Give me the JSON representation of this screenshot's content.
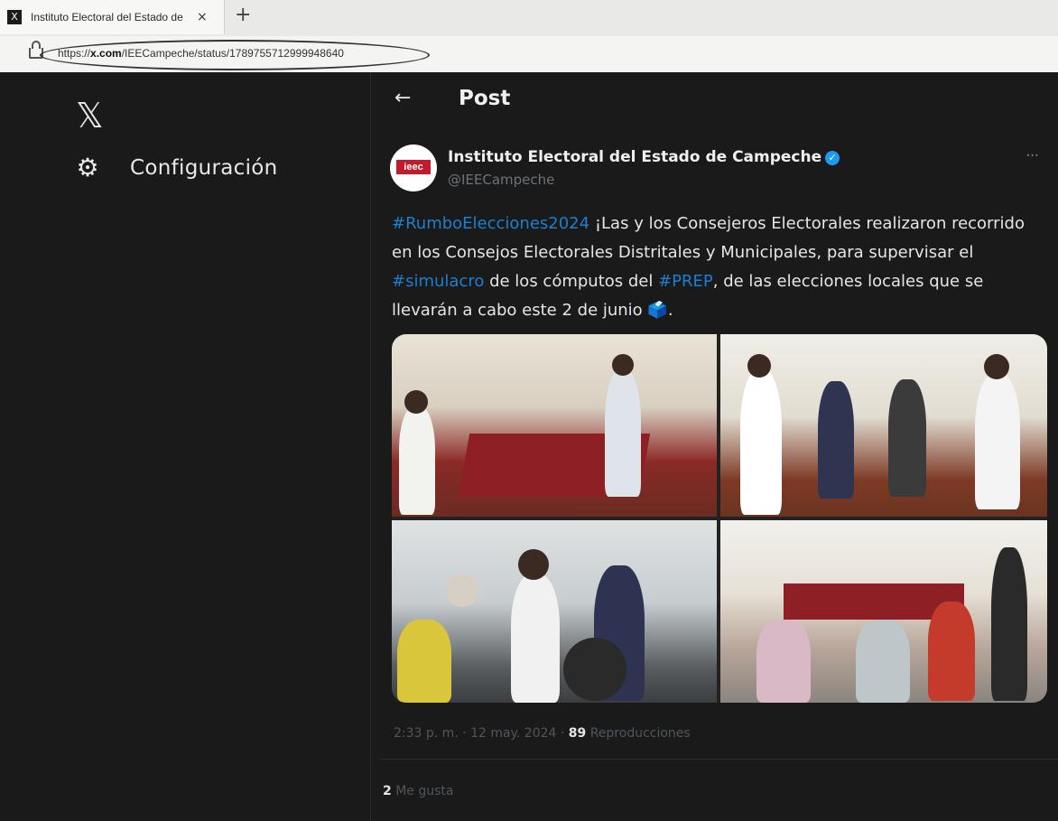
{
  "browser": {
    "tab_title": "Instituto Electoral del Estado de",
    "tab_close": "×",
    "new_tab": "+",
    "url_prefix": "https://",
    "url_domain": "x.com",
    "url_path": "/IEECampeche/status/1789755712999948640"
  },
  "sidebar": {
    "logo": "𝕏",
    "items": [
      {
        "label": "Configuración",
        "icon": "gear-icon"
      }
    ]
  },
  "header": {
    "back": "←",
    "title": "Post"
  },
  "post": {
    "author_name": "Instituto Electoral del Estado de Campeche",
    "author_handle": "@IEECampeche",
    "avatar_text": "ieec",
    "text": {
      "tag1": "#RumboElecciones2024",
      "part1": " ¡Las y los Consejeros Electorales realizaron recorrido en los Consejos Electorales Distritales y Municipales, para supervisar el ",
      "tag2": "#simulacro",
      "part2": " de los cómputos del ",
      "tag3": "#PREP",
      "part3": ", de las elecciones locales que se llevarán a cabo este 2 de junio 🗳️."
    },
    "timestamp": "2:33 p. m. · 12 may. 2024 · ",
    "views_count": "89",
    "views_label": " Reproducciones",
    "likes_count": "2",
    "likes_label": " Me gusta"
  },
  "colors": {
    "background": "#1a1a1a",
    "hashtag": "#1d7fd0",
    "verified": "#1d9bf0"
  }
}
